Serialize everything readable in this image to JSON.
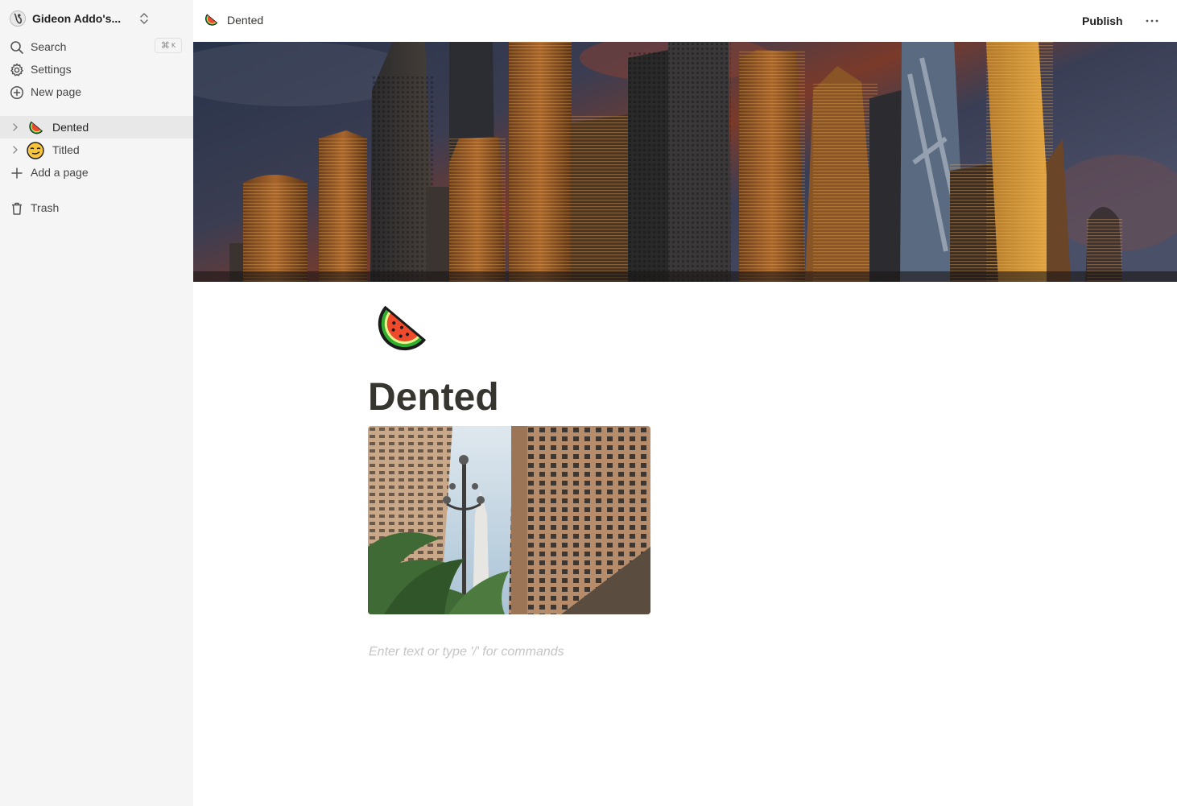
{
  "workspace": {
    "name": "Gideon Addo's..."
  },
  "sidebar": {
    "search": {
      "label": "Search",
      "shortcut_symbol": "⌘",
      "shortcut_key": "K"
    },
    "settings": {
      "label": "Settings"
    },
    "new_page": {
      "label": "New page"
    },
    "pages": [
      {
        "label": "Dented",
        "icon": "watermelon-emoji",
        "active": true
      },
      {
        "label": "Titled",
        "icon": "smirking-face-emoji",
        "active": false
      }
    ],
    "add_page": {
      "label": "Add a page"
    },
    "trash": {
      "label": "Trash"
    }
  },
  "topbar": {
    "breadcrumb": "Dented",
    "breadcrumb_icon": "watermelon-emoji",
    "publish_label": "Publish",
    "more_icon": "ellipsis-icon"
  },
  "page": {
    "icon": "watermelon-emoji",
    "title": "Dented",
    "cover_image": "city-skyline-at-dusk",
    "image_block": "street-lamp-palms-and-buildings-photo",
    "editor_placeholder": "Enter text or type '/' for commands"
  },
  "colors": {
    "sidebar_bg": "#f5f5f5",
    "active_row_bg": "#e8e8e8",
    "text": "#37352f",
    "placeholder": "#c5c5c5"
  }
}
